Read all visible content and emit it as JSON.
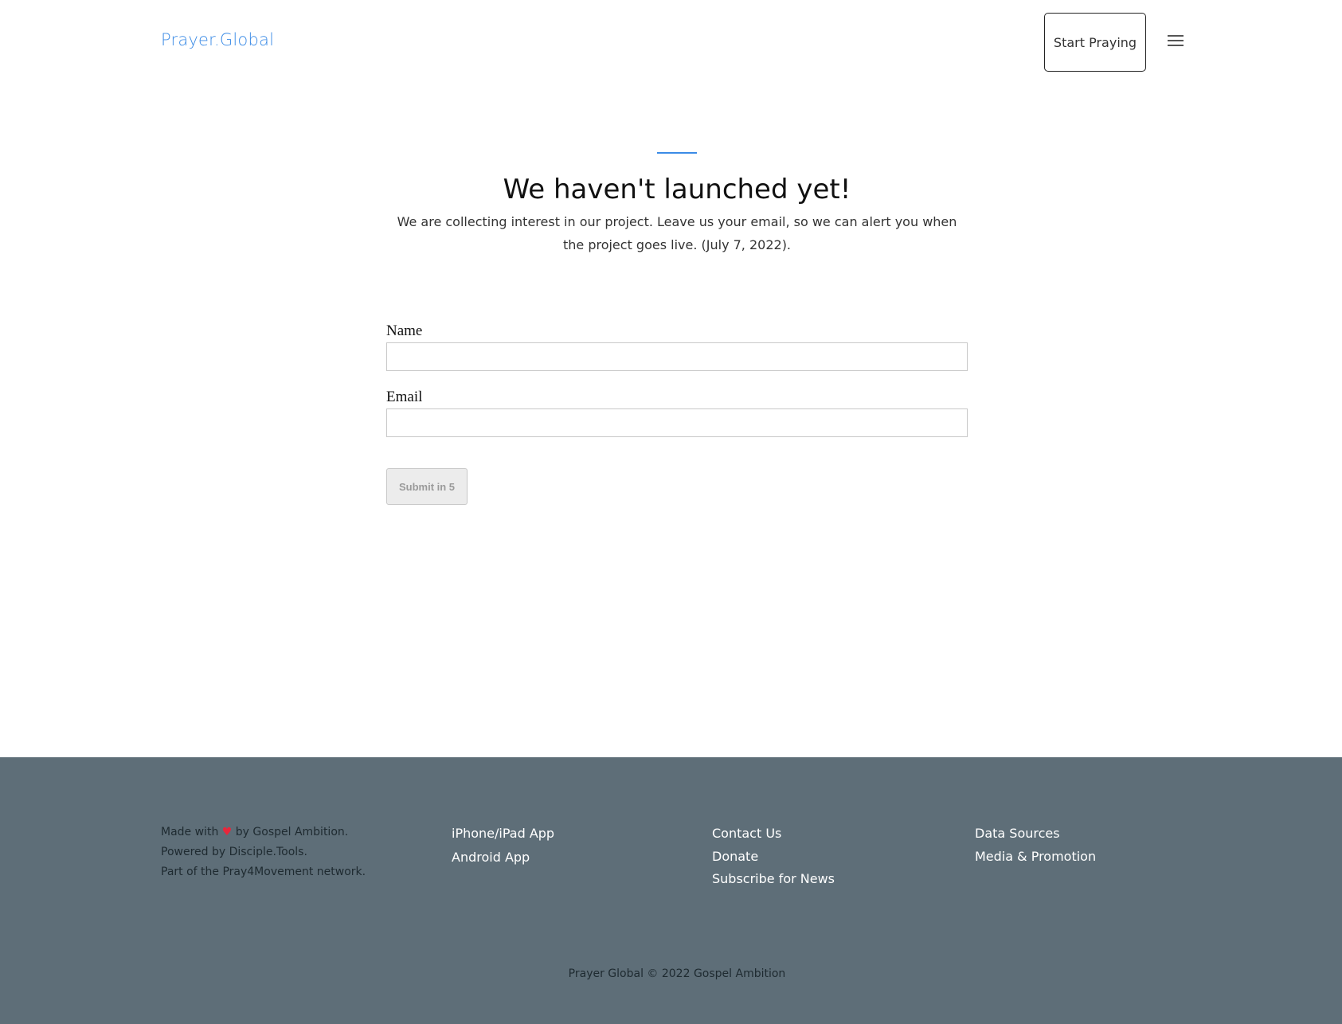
{
  "header": {
    "brand": "Prayer.Global",
    "start_button": "Start Praying",
    "menu_icon": "hamburger-menu-icon"
  },
  "hero": {
    "accent_color": "#3b8be6",
    "title": "We haven't launched yet!",
    "description": "We are collecting interest in our project. Leave us your email, so we can alert you when the project goes live. (July 7, 2022)."
  },
  "form": {
    "name_label": "Name",
    "name_value": "",
    "email_label": "Email",
    "email_value": "",
    "submit_label": "Submit in 5"
  },
  "footer": {
    "background": "#5e6e78",
    "about": {
      "made_with_prefix": "Made with",
      "heart": "♥",
      "made_with_suffix": "by Gospel Ambition.",
      "powered_by": "Powered by Disciple.Tools.",
      "network": "Part of the Pray4Movement network."
    },
    "apps": [
      {
        "icon": "apple-icon",
        "glyph": "",
        "label": "iPhone/iPad App"
      },
      {
        "icon": "android-icon",
        "glyph": "",
        "label": "Android App"
      }
    ],
    "links_1": [
      "Contact Us",
      "Donate",
      "Subscribe for News"
    ],
    "links_2": [
      "Data Sources",
      "Media & Promotion"
    ],
    "copyright": "Prayer Global © 2022 Gospel Ambition"
  }
}
